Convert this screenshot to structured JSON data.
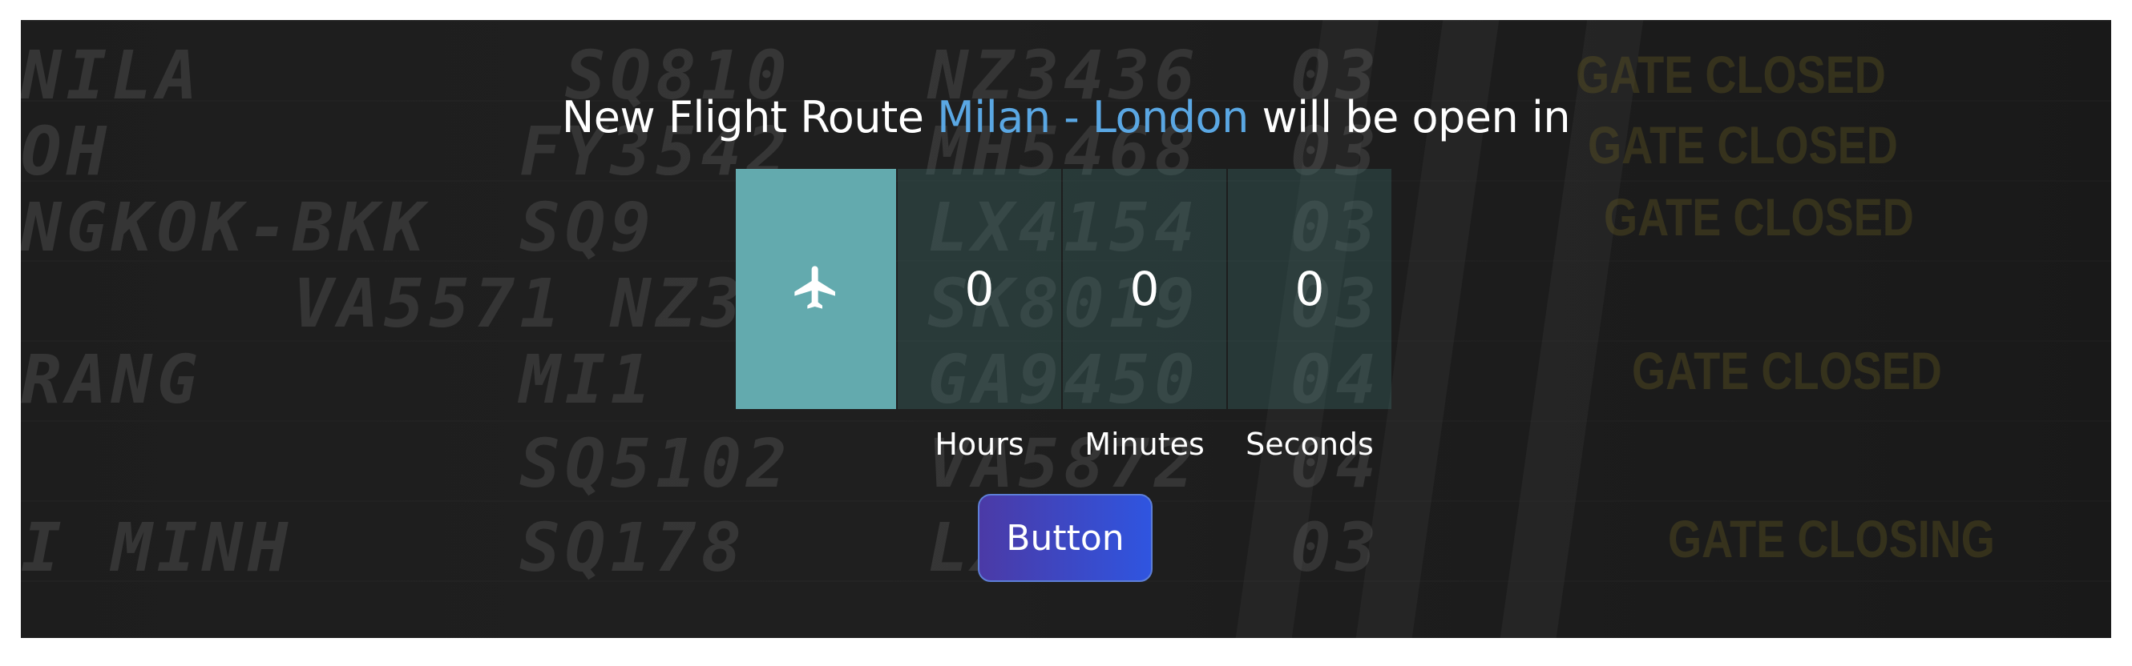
{
  "headline": {
    "prefix": "New Flight Route ",
    "route": "Milan - London",
    "suffix": " will be open in"
  },
  "countdown": {
    "icon": "airplane-icon",
    "units": [
      {
        "value": "0",
        "label": "Hours"
      },
      {
        "value": "0",
        "label": "Minutes"
      },
      {
        "value": "0",
        "label": "Seconds"
      }
    ]
  },
  "cta": {
    "label": "Button"
  },
  "background_board": {
    "rows": [
      "NILA        SQ810   NZ3436  03",
      "OH         FY3542   MH5468  03",
      "NGKOK-BKK  SQ9      LX4154  03",
      "      VA5571 NZ3    SK8019  03",
      "RANG       MI1      GA9450  04",
      "           SQ5102   VA5872  04",
      "I MINH     SQ178    LX456   03"
    ],
    "gates": [
      "GATE CLOSED",
      "GATE CLOSED",
      "GATE CLOSED",
      "GATE CLOSED",
      "GATE CLOSING"
    ]
  },
  "colors": {
    "accent": "#5aa7e3",
    "plane_tile": "#63aaae",
    "button_start": "#4b3aa6",
    "button_end": "#2f55e0"
  }
}
